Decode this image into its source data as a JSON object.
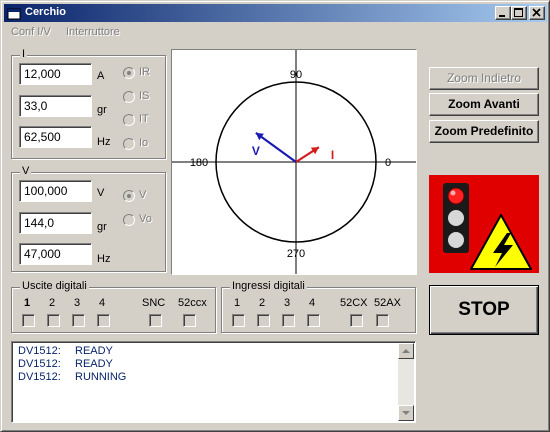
{
  "window": {
    "title": "Cerchio"
  },
  "menu": [
    {
      "label": "Conf I/V"
    },
    {
      "label": "Interruttore"
    }
  ],
  "current_group": {
    "legend": "I",
    "fields": [
      {
        "value": "12,000",
        "unit": "A"
      },
      {
        "value": "33,0",
        "unit": "gr"
      },
      {
        "value": "62,500",
        "unit": "Hz"
      }
    ],
    "radios": [
      {
        "label": "IR",
        "selected": true
      },
      {
        "label": "IS",
        "selected": false
      },
      {
        "label": "IT",
        "selected": false
      },
      {
        "label": "Io",
        "selected": false
      }
    ]
  },
  "voltage_group": {
    "legend": "V",
    "fields": [
      {
        "value": "100,000",
        "unit": "V"
      },
      {
        "value": "144,0",
        "unit": "gr"
      },
      {
        "value": "47,000",
        "unit": "Hz"
      }
    ],
    "radios": [
      {
        "label": "V",
        "selected": true
      },
      {
        "label": "Vo",
        "selected": false
      }
    ]
  },
  "phasor_plot": {
    "angle_labels": {
      "top": "90",
      "left": "180",
      "right": "0",
      "bottom": "270"
    },
    "vectors": [
      {
        "label": "V",
        "angle_deg": 144,
        "magnitude": 1.0,
        "color": "#1a1ab4"
      },
      {
        "label": "I",
        "angle_deg": 33,
        "magnitude": 0.55,
        "color": "#d21e1e"
      }
    ]
  },
  "buttons": {
    "zoom_back": "Zoom Indietro",
    "zoom_forward": "Zoom Avanti",
    "zoom_default": "Zoom Predefinito",
    "stop": "STOP"
  },
  "digital_outputs": {
    "legend": "Uscite digitali",
    "items": [
      "1",
      "2",
      "3",
      "4",
      "SNC",
      "52ccx"
    ]
  },
  "digital_inputs": {
    "legend": "Ingressi digitali",
    "items": [
      "1",
      "2",
      "3",
      "4",
      "52CX",
      "52AX"
    ]
  },
  "log": [
    {
      "id": "DV1512:",
      "msg": "READY"
    },
    {
      "id": "DV1512:",
      "msg": "READY"
    },
    {
      "id": "DV1512:",
      "msg": "RUNNING"
    }
  ],
  "colors": {
    "titlebar_start": "#0a246a",
    "titlebar_end": "#a6caf0",
    "alarm_bg": "#e00000",
    "warning_yellow": "#ffff00",
    "traffic_red": "#ff2020"
  }
}
